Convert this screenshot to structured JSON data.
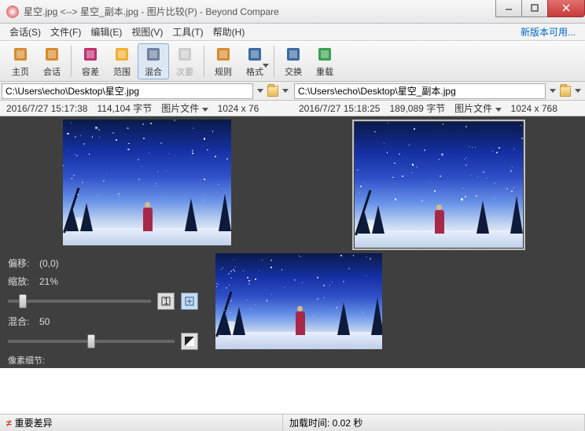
{
  "title": "星空.jpg <--> 星空_副本.jpg - 图片比较(P) - Beyond Compare",
  "update_link": "新版本可用...",
  "menu": [
    "会话(S)",
    "文件(F)",
    "编辑(E)",
    "视图(V)",
    "工具(T)",
    "帮助(H)"
  ],
  "toolbar": [
    {
      "label": "主页",
      "icon": "home",
      "color": "#d68b2e"
    },
    {
      "label": "会话",
      "icon": "briefcase",
      "color": "#d68b2e"
    },
    {
      "sep": true
    },
    {
      "label": "容差",
      "icon": "tolerance",
      "color": "#c03070"
    },
    {
      "label": "范围",
      "icon": "range",
      "color": "#f0b030"
    },
    {
      "label": "混合",
      "icon": "blend",
      "color": "#7080a0",
      "active": true
    },
    {
      "label": "次要",
      "icon": "minor",
      "color": "#7080a0",
      "disabled": true
    },
    {
      "sep": true
    },
    {
      "label": "规则",
      "icon": "rules",
      "color": "#d68b2e"
    },
    {
      "label": "格式",
      "icon": "format",
      "color": "#3a6aa0",
      "dd": true
    },
    {
      "sep": true
    },
    {
      "label": "交换",
      "icon": "swap",
      "color": "#3a6aa0"
    },
    {
      "label": "重载",
      "icon": "reload",
      "color": "#3aa050"
    }
  ],
  "paths": {
    "left": "C:\\Users\\echo\\Desktop\\星空.jpg",
    "right": "C:\\Users\\echo\\Desktop\\星空_副本.jpg"
  },
  "info": {
    "left": {
      "date": "2016/7/27 15:17:38",
      "size": "114,104 字节",
      "type": "图片文件",
      "dim": "1024 x 76"
    },
    "right": {
      "date": "2016/7/27 15:18:25",
      "size": "189,089 字节",
      "type": "图片文件",
      "dim": "1024 x 768"
    }
  },
  "ctl": {
    "offset_label": "偏移:",
    "offset_value": "(0,0)",
    "zoom_label": "缩放:",
    "zoom_value": "21%",
    "blend_label": "混合:",
    "blend_value": "50",
    "pixel_label": "像素细节:"
  },
  "status": {
    "diff": "重要差异",
    "load": "加载时间: 0.02 秒"
  }
}
